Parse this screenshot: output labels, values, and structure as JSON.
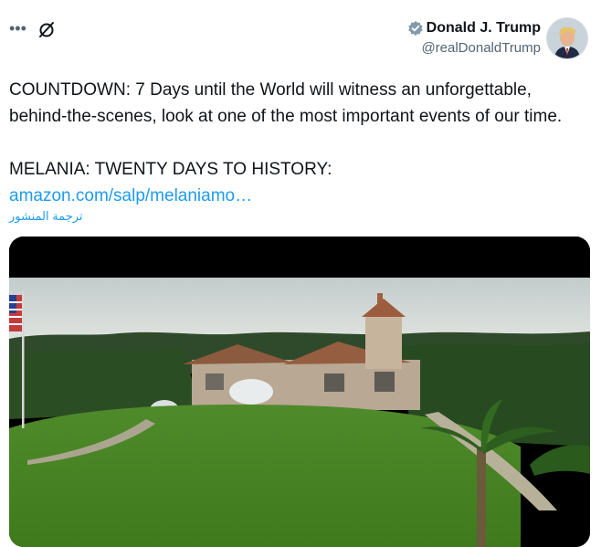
{
  "author": {
    "display_name": "Donald J. Trump",
    "handle": "@realDonaldTrump",
    "verified": true
  },
  "header": {
    "more_icon": "more-dots-icon",
    "grok_icon": "grok-icon"
  },
  "tweet": {
    "line1": "COUNTDOWN: 7 Days until the World will witness an unforgettable,",
    "line2": "behind-the-scenes, look at one of the most important events of our time.",
    "line3": "MELANIA: TWENTY DAYS TO HISTORY:",
    "link": "amazon.com/salp/melaniamo…",
    "translate": "ترجمة المنشور"
  },
  "colors": {
    "link": "#1d9bf0",
    "text": "#0f1419",
    "muted": "#536471",
    "verified": "#829aab"
  }
}
